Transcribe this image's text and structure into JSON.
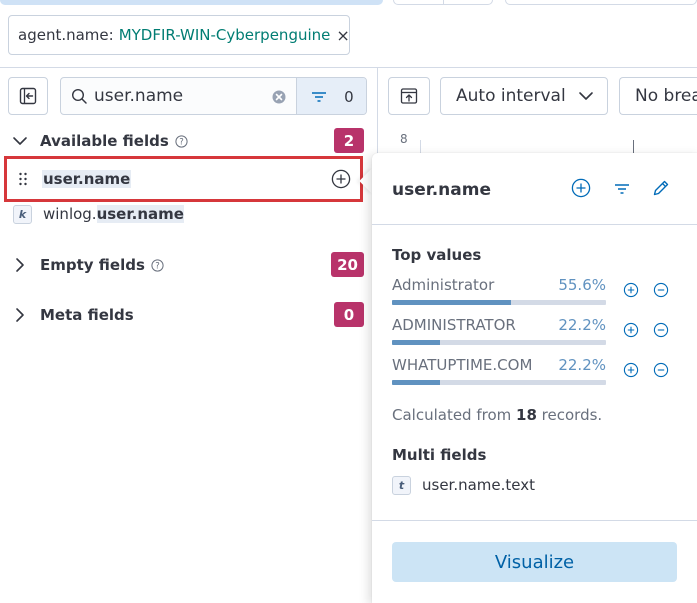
{
  "filter": {
    "key": "agent.name:",
    "value": "MYDFIR-WIN-Cyberpenguine",
    "close_glyph": "×"
  },
  "sidebar": {
    "search_value": "user.name",
    "filter_count": "0",
    "groups": {
      "available": {
        "title": "Available fields",
        "count": "2"
      },
      "empty": {
        "title": "Empty fields",
        "count": "20"
      },
      "meta": {
        "title": "Meta fields",
        "count": "0"
      }
    },
    "fields": [
      {
        "name": "user.name"
      },
      {
        "type_token": "k",
        "prefix": "winlog.",
        "highlight": "user.name"
      }
    ]
  },
  "toolbar": {
    "interval": "Auto interval",
    "breakdown": "No breakdown"
  },
  "chart": {
    "axis_tick": "8"
  },
  "popover": {
    "title": "user.name",
    "top_values_title": "Top values",
    "top_values": [
      {
        "label": "Administrator",
        "percent": "55.6%",
        "fraction": 0.556
      },
      {
        "label": "ADMINISTRATOR",
        "percent": "22.2%",
        "fraction": 0.222
      },
      {
        "label": "WHATUPTIME.COM",
        "percent": "22.2%",
        "fraction": 0.222
      }
    ],
    "calc_prefix": "Calculated from ",
    "calc_count": "18",
    "calc_suffix": " records.",
    "multi_fields_title": "Multi fields",
    "multi_field": {
      "type_token": "t",
      "name": "user.name.text"
    },
    "visualize_label": "Visualize"
  },
  "colors": {
    "accent": "#006bb8",
    "badge": "#b8336a",
    "selected_border": "#d6373b",
    "bar_fill": "#6092c0",
    "filter_value": "#017d73"
  },
  "icons": [
    "collapse-sidebar-icon",
    "search-icon",
    "clear-icon",
    "filter-icon",
    "chevron-down-icon",
    "chevron-right-icon",
    "help-icon",
    "drag-handle-icon",
    "plus-circle-icon",
    "minus-circle-icon",
    "pencil-icon",
    "chart-options-icon"
  ]
}
